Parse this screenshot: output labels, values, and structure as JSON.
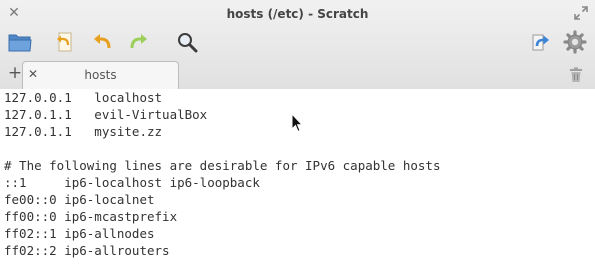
{
  "window": {
    "title": "hosts (/etc) - Scratch"
  },
  "tabs": [
    {
      "label": "hosts"
    }
  ],
  "editor": {
    "lines": [
      "127.0.0.1   localhost",
      "127.0.1.1   evil-VirtualBox",
      "127.0.1.1   mysite.zz",
      "",
      "# The following lines are desirable for IPv6 capable hosts",
      "::1     ip6-localhost ip6-loopback",
      "fe00::0 ip6-localnet",
      "ff00::0 ip6-mcastprefix",
      "ff02::1 ip6-allnodes",
      "ff02::2 ip6-allrouters"
    ]
  },
  "colors": {
    "folder": "#5b8fc9",
    "undo": "#e8a020",
    "redo": "#8cc63f",
    "share": "#3b84d8"
  },
  "icons": [
    "close-icon",
    "maximize-icon",
    "folder-open-icon",
    "revert-icon",
    "undo-icon",
    "redo-icon",
    "search-icon",
    "share-icon",
    "gear-icon",
    "new-tab-icon",
    "tab-close-icon",
    "trash-icon",
    "mouse-cursor-icon"
  ]
}
